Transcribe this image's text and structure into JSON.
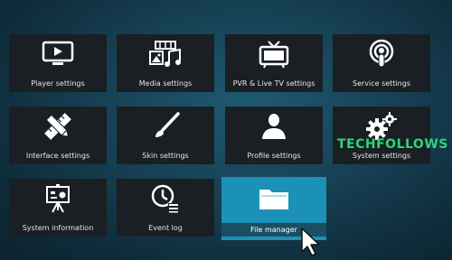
{
  "tiles": [
    {
      "name": "player-settings",
      "label": "Player settings",
      "icon": "tv-play-icon"
    },
    {
      "name": "media-settings",
      "label": "Media settings",
      "icon": "media-icon"
    },
    {
      "name": "pvr-live-tv-settings",
      "label": "PVR & Live TV settings",
      "icon": "tv-antenna-icon"
    },
    {
      "name": "service-settings",
      "label": "Service settings",
      "icon": "podcast-icon"
    },
    {
      "name": "interface-settings",
      "label": "Interface settings",
      "icon": "pencil-ruler-icon"
    },
    {
      "name": "skin-settings",
      "label": "Skin settings",
      "icon": "paintbrush-icon"
    },
    {
      "name": "profile-settings",
      "label": "Profile settings",
      "icon": "user-icon"
    },
    {
      "name": "system-settings",
      "label": "System settings",
      "icon": "gears-icon"
    },
    {
      "name": "system-information",
      "label": "System information",
      "icon": "presentation-icon"
    },
    {
      "name": "event-log",
      "label": "Event log",
      "icon": "clock-list-icon"
    },
    {
      "name": "file-manager",
      "label": "File manager",
      "icon": "folder-icon",
      "selected": true
    }
  ],
  "watermark": "TECHFOLLOWS",
  "colors": {
    "tile_bg": "#1a1f24",
    "selected_bg": "#1c91b8",
    "watermark": "#2fd37a"
  }
}
